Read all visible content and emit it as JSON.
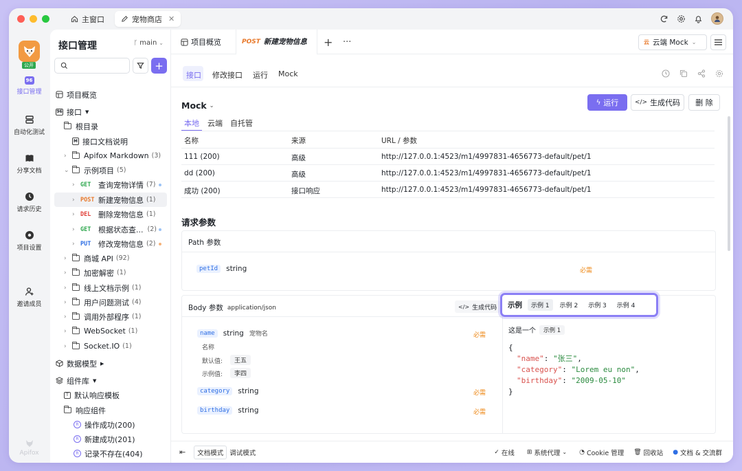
{
  "window_tabs": [
    {
      "label": "主窗口"
    },
    {
      "label": "宠物商店"
    }
  ],
  "rail": [
    {
      "label": "公开"
    },
    {
      "label": "接口管理"
    },
    {
      "label": "自动化测试"
    },
    {
      "label": "分享文档"
    },
    {
      "label": "请求历史"
    },
    {
      "label": "项目设置"
    },
    {
      "label": "邀请成员"
    },
    {
      "label": "Apifox"
    }
  ],
  "sidebar": {
    "title": "接口管理",
    "branch": "main",
    "search_placeholder": "",
    "tree": [
      {
        "label": "项目概览"
      },
      {
        "label": "接口"
      },
      {
        "label": "根目录"
      },
      {
        "label": "接口文档说明"
      },
      {
        "label": "Apifox Markdown",
        "count": "(3)"
      },
      {
        "label": "示例项目",
        "count": "(5)"
      },
      {
        "method": "GET",
        "label": "查询宠物详情",
        "count": "(7)"
      },
      {
        "method": "POST",
        "label": "新建宠物信息",
        "count": "(1)"
      },
      {
        "method": "DEL",
        "label": "删除宠物信息",
        "count": "(1)"
      },
      {
        "method": "GET",
        "label": "根据状态查...",
        "count": "(2)"
      },
      {
        "method": "PUT",
        "label": "修改宠物信息",
        "count": "(2)"
      },
      {
        "label": "商城 API",
        "count": "(92)"
      },
      {
        "label": "加密解密",
        "count": "(1)"
      },
      {
        "label": "线上文档示例",
        "count": "(1)"
      },
      {
        "label": "用户问题测试",
        "count": "(4)"
      },
      {
        "label": "调用外部程序",
        "count": "(1)"
      },
      {
        "label": "WebSocket",
        "count": "(1)"
      },
      {
        "label": "Socket.IO",
        "count": "(1)"
      },
      {
        "label": "数据模型"
      },
      {
        "label": "组件库"
      },
      {
        "label": "默认响应模板"
      },
      {
        "label": "响应组件"
      },
      {
        "label": "操作成功(200)"
      },
      {
        "label": "新建成功(201)"
      },
      {
        "label": "记录不存在(404)"
      }
    ]
  },
  "main": {
    "tabs": {
      "overview": "项目概览",
      "active_method": "POST",
      "active_label": "新建宠物信息"
    },
    "env": "云端 Mock",
    "subtabs": [
      "接口",
      "修改接口",
      "运行",
      "Mock"
    ],
    "mock": {
      "title": "Mock",
      "run": "运行",
      "gencode": "生成代码",
      "delete": "删 除",
      "scopes": [
        "本地",
        "云端",
        "自托管"
      ],
      "headers": [
        "名称",
        "来源",
        "URL / 参数"
      ],
      "rows": [
        [
          "111 (200)",
          "高级",
          "http://127.0.0.1:4523/m1/4997831-4656773-default/pet/1"
        ],
        [
          "dd (200)",
          "高级",
          "http://127.0.0.1:4523/m1/4997831-4656773-default/pet/1"
        ],
        [
          "成功 (200)",
          "接口响应",
          "http://127.0.0.1:4523/m1/4997831-4656773-default/pet/1"
        ]
      ]
    },
    "params": {
      "title": "请求参数",
      "path_title": "Path 参数",
      "path_param": {
        "name": "petId",
        "type": "string",
        "required": "必需"
      },
      "body_title": "Body 参数",
      "body_type": "application/json",
      "body_gencode": "生成代码",
      "body_params": [
        {
          "name": "name",
          "type": "string",
          "desc": "宠物名",
          "sub": "名称",
          "default_label": "默认值:",
          "default": "王五",
          "example_label": "示例值:",
          "example": "李四",
          "required": "必需"
        },
        {
          "name": "category",
          "type": "string",
          "required": "必需"
        },
        {
          "name": "birthday",
          "type": "string",
          "required": "必需"
        }
      ],
      "examples": {
        "title": "示例",
        "tabs": [
          "示例 1",
          "示例 2",
          "示例 3",
          "示例 4"
        ],
        "caption": "这是一个",
        "caption_tag": "示例 1",
        "code": {
          "open": "{",
          "close": "}",
          "lines": [
            {
              "key": "\"name\"",
              "val": "\"张三\"",
              "end": ","
            },
            {
              "key": "\"category\"",
              "val": "\"Lorem eu non\"",
              "end": ","
            },
            {
              "key": "\"birthday\"",
              "val": "\"2009-05-10\"",
              "end": ""
            }
          ]
        }
      }
    },
    "bottom": {
      "doc_mode": "文档模式",
      "debug_mode": "调试模式",
      "online": "在线",
      "proxy": "系统代理",
      "cookie": "Cookie 管理",
      "recycle": "回收站",
      "community": "文档 & 交流群"
    }
  },
  "colors": {
    "accent": "#7a6ef0",
    "get": "#2fa84f",
    "post": "#e8792b",
    "del": "#e0413a",
    "put": "#2f6fe4"
  }
}
